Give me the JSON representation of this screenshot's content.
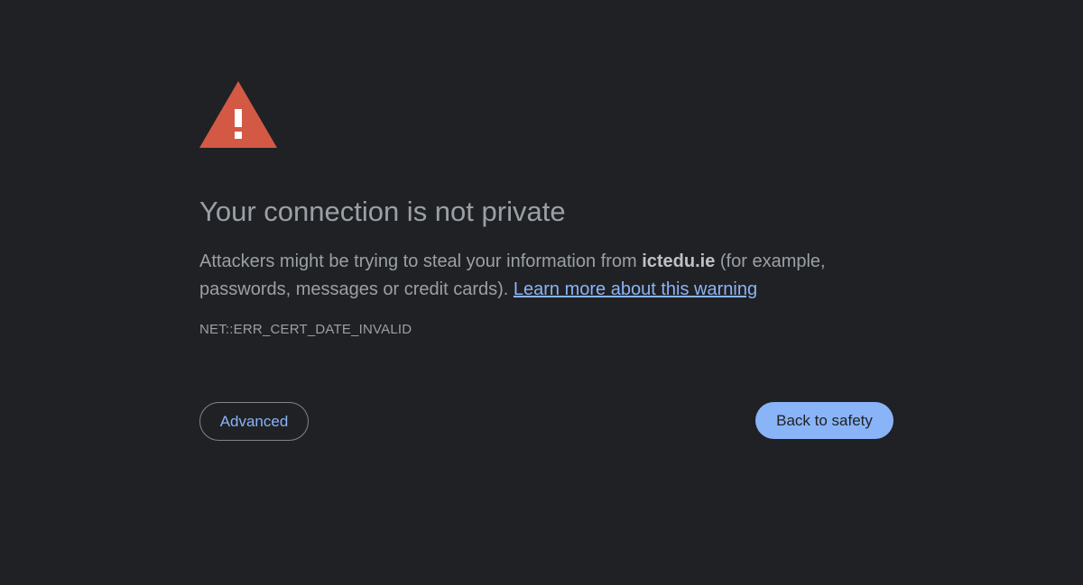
{
  "icon": {
    "name": "warning-triangle-icon",
    "color": "#d35945"
  },
  "main": {
    "title": "Your connection is not private",
    "message_prefix": "Attackers might be trying to steal your information from ",
    "domain": "ictedu.ie",
    "message_suffix": " (for example, passwords, messages or credit cards). ",
    "learn_more_link": "Learn more about this warning",
    "error_code": "NET::ERR_CERT_DATE_INVALID"
  },
  "buttons": {
    "advanced_label": "Advanced",
    "back_label": "Back to safety"
  },
  "colors": {
    "background": "#202124",
    "text": "#9aa0a6",
    "link": "#8ab4f8",
    "primary_button": "#8ab4f8"
  }
}
